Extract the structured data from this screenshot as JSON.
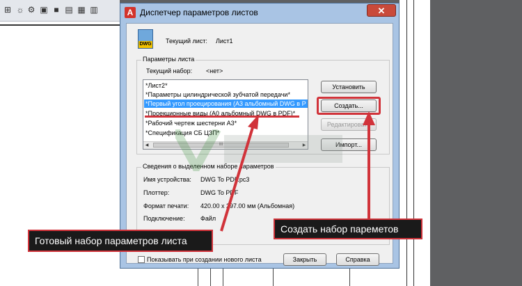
{
  "window": {
    "title": "Диспетчер параметров листов",
    "close_symbol": "✕",
    "app_icon_letter": "A"
  },
  "current_sheet": {
    "icon_label": "DWG",
    "label": "Текущий лист:",
    "value": "Лист1"
  },
  "sheet_params": {
    "group_label": "Параметры листа",
    "current_set_label": "Текущий набор:",
    "current_set_value": "<нет>",
    "list_items": [
      "*Лист2*",
      "*Параметры цилиндрической зубчатой передачи*",
      "*Первый угол проецирования (А3 альбомный DWG в P",
      "*Проекционные виды (А0 альбомный DWG в PDF)*",
      "*Рабочий чертеж шестерни А3*",
      "*Спецификация СБ ЦЗП*"
    ],
    "selected_index": 2,
    "scrollbar_thumb_text": "III"
  },
  "buttons": {
    "set": "Установить",
    "create": "Создать...",
    "edit": "Редактировать",
    "import": "Импорт...",
    "close": "Закрыть",
    "help": "Справка"
  },
  "details": {
    "group_label": "Сведения о выделенном наборе параметров",
    "rows": [
      {
        "label": "Имя устройства:",
        "value": "DWG To PDF.pc3"
      },
      {
        "label": "Плоттер:",
        "value": "DWG To PDF"
      },
      {
        "label": "Формат печати:",
        "value": "420.00 x 297.00 мм (Альбомная)"
      },
      {
        "label": "Подключение:",
        "value": "Файл"
      }
    ]
  },
  "show_on_new_sheet": {
    "label": "Показывать при создании нового листа",
    "checked": false
  },
  "annotations": {
    "left_callout": "Готовый набор параметров листа",
    "right_callout": "Создать набор пареметов",
    "color": "#d1333a"
  }
}
